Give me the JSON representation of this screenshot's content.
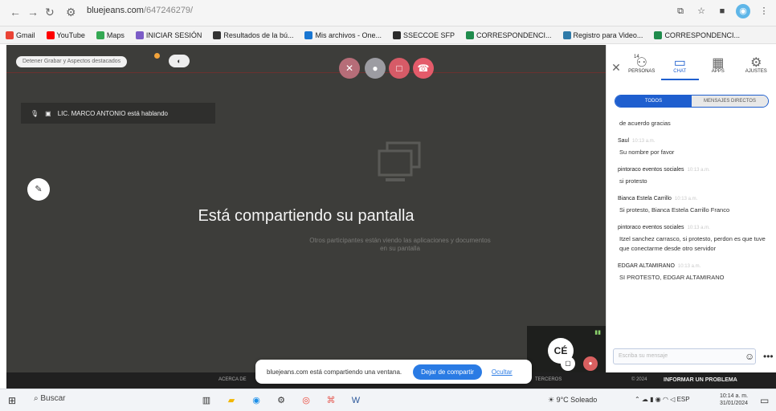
{
  "browser": {
    "url_host": "bluejeans.com",
    "url_path": "/647246279/",
    "tabs_icons": [
      "cast-icon",
      "star-icon",
      "window-icon",
      "profile-icon",
      "menu-icon"
    ]
  },
  "bookmarks": [
    {
      "label": "Gmail",
      "color": "#ea4335"
    },
    {
      "label": "YouTube",
      "color": "#ff0000"
    },
    {
      "label": "Maps",
      "color": "#34a853"
    },
    {
      "label": "INICIAR SESIÓN",
      "color": "#7b5cc7"
    },
    {
      "label": "Resultados de la bú...",
      "color": "#333333"
    },
    {
      "label": "Mis archivos - One...",
      "color": "#1976d2"
    },
    {
      "label": "SSECCOE SFP",
      "color": "#2c2c2c"
    },
    {
      "label": "CORRESPONDENCI...",
      "color": "#1f8b4c"
    },
    {
      "label": "Registro para Video...",
      "color": "#2f7aa8"
    },
    {
      "label": "CORRESPONDENCI...",
      "color": "#1f8b4c"
    }
  ],
  "meeting": {
    "record_button": "Detener Grabar y Aspectos destacados",
    "speaker_label": "LIC. MARCO ANTONIO está hablando",
    "share_title": "Está compartiendo su pantalla",
    "share_sub": "Otros participantes están viendo las aplicaciones y documentos en su pantalla",
    "participant_initials": "CÉ",
    "share_notice": "bluejeans.com está compartiendo una ventana.",
    "stop_share": "Dejar de compartir",
    "hide": "Ocultar",
    "bottom_left": "ACERCA DE",
    "bottom_mid": "TERCEROS",
    "bottom_copy": "© 2024",
    "report": "INFORMAR UN PROBLEMA"
  },
  "panel": {
    "tabs": [
      {
        "label": "PERSONAS",
        "icon": "people-icon",
        "count": "14"
      },
      {
        "label": "CHAT",
        "icon": "chat-icon"
      },
      {
        "label": "APPS",
        "icon": "apps-icon"
      },
      {
        "label": "AJUSTES",
        "icon": "gear-icon"
      }
    ],
    "segments": [
      "TODOS",
      "MENSAJES DIRECTOS"
    ],
    "messages": [
      {
        "sender": "",
        "time": "",
        "text": "de acuerdo gracias"
      },
      {
        "sender": "Saul",
        "time": "10:13 a.m.",
        "text": "Su nombre por favor"
      },
      {
        "sender": "pintoraco eventos sociales",
        "time": "10:13 a.m.",
        "text": "si protesto"
      },
      {
        "sender": "Bianca Estela Carrillo",
        "time": "10:13 a.m.",
        "text": "Si protesto, Bianca Estela Carrillo Franco"
      },
      {
        "sender": "pintoraco eventos sociales",
        "time": "10:13 a.m.",
        "text": "Itzel sanchez carrasco, si protesto, perdon es que tuve que conectarme desde otro servidor"
      },
      {
        "sender": "EDGAR ALTAMIRANO",
        "time": "10:13 a.m.",
        "text": "SI PROTESTO, EDGAR ALTAMIRANO"
      }
    ],
    "input_placeholder": "Escriba su mensaje"
  },
  "taskbar": {
    "search": "Buscar",
    "weather": "9°C Soleado",
    "lang": "ESP",
    "time": "10:14 a. m.",
    "date": "31/01/2024"
  }
}
